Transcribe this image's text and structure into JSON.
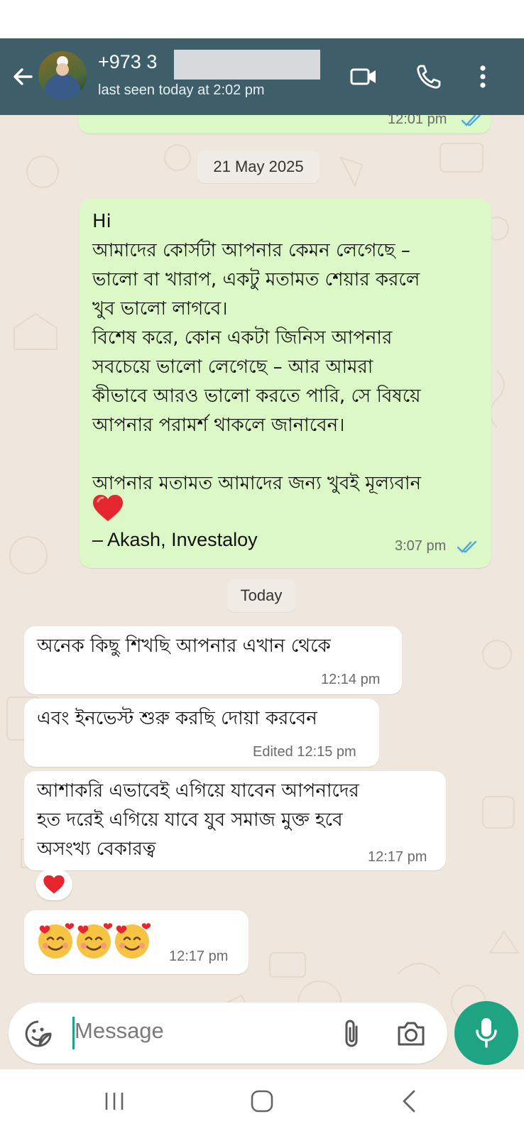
{
  "header": {
    "contact_number": "+973 3",
    "last_seen": "last seen today at 2:02 pm",
    "icons": [
      "back-arrow-icon",
      "avatar",
      "video-call-icon",
      "voice-call-icon",
      "more-options-icon"
    ]
  },
  "messages": {
    "prev_out_time": "12:01 pm",
    "date_chip_1": "21 May 2025",
    "out_1_text": "Hi\nআমাদের কোর্সটা আপনার কেমন লেগেছে –\nভালো বা খারাপ, একটু মতামত শেয়ার করলে\nখুব ভালো লাগবে।\nবিশেষ করে, কোন একটা জিনিস আপনার\nসবচেয়ে ভালো লেগেছে – আর আমরা\nকীভাবে আরও ভালো করতে পারি, সে বিষয়ে\nআপনার পরামর্শ থাকলে জানাবেন।\n\nআপনার মতামত আমাদের জন্য খুবই মূল্যবান",
    "out_1_signature": "– Akash, Investaloy",
    "out_1_time": "3:07 pm",
    "date_chip_2": "Today",
    "in_1_text": "অনেক কিছু শিখছি আপনার এখান থেকে",
    "in_1_time": "12:14 pm",
    "in_2_text": "এবং ইনভেস্ট শুরু করছি দোয়া করবেন",
    "in_2_time": "Edited 12:15 pm",
    "in_3_text": "আশাকরি এভাবেই এগিয়ে যাবেন আপনাদের\nহত দরেই এগিয়ে যাবে যুব সমাজ মুক্ত হবে\nঅসংখ্য বেকারত্ব",
    "in_3_time": "12:17 pm",
    "in_4_time": "12:17 pm"
  },
  "input": {
    "placeholder": "Message",
    "icons": [
      "emoji-sticker-icon",
      "attach-icon",
      "camera-icon",
      "mic-icon"
    ]
  },
  "colors": {
    "header": "#3e5f6a",
    "outgoing": "#dcf8c6",
    "incoming": "#ffffff",
    "accent": "#1ea383",
    "read_ticks": "#4fa6e0"
  }
}
